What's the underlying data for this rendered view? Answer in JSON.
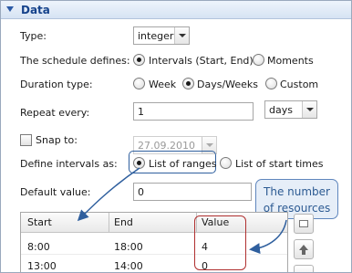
{
  "section": {
    "title": "Data"
  },
  "type": {
    "label": "Type:",
    "value": "integer"
  },
  "schedule": {
    "label": "The schedule defines:",
    "opt1": "Intervals (Start, End)",
    "opt2": "Moments"
  },
  "duration": {
    "label": "Duration type:",
    "opt1": "Week",
    "opt2": "Days/Weeks",
    "opt3": "Custom"
  },
  "repeat": {
    "label": "Repeat every:",
    "value": "1",
    "unit": "days"
  },
  "snap": {
    "label": "Snap to:",
    "date": "27.09.2010"
  },
  "define": {
    "label": "Define intervals as:",
    "opt1": "List of ranges",
    "opt2": "List of start times"
  },
  "default_value": {
    "label": "Default value:",
    "value": "0"
  },
  "callout": {
    "line1": "The number",
    "line2": "of resources"
  },
  "table": {
    "headers": [
      "Start",
      "End",
      "Value"
    ],
    "rows": [
      [
        "8:00",
        "18:00",
        "4"
      ],
      [
        "13:00",
        "14:00",
        "0"
      ]
    ]
  },
  "colors": {
    "header_text": "#15428b",
    "annotation": "#2f5f9e",
    "value_highlight": "#b03030"
  }
}
